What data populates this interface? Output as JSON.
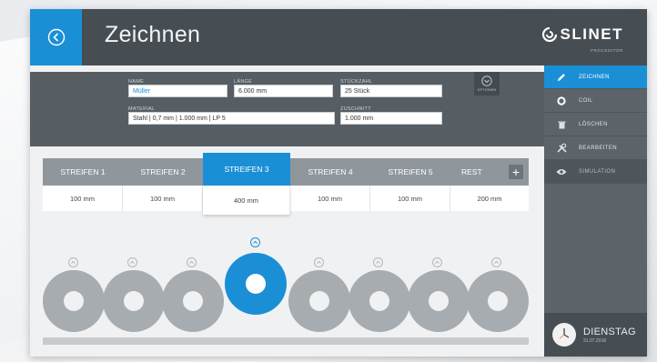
{
  "header": {
    "title": "Zeichnen",
    "brand": "SLINET",
    "brand_sub": "PROCEDITOR"
  },
  "form": {
    "name_label": "NAME",
    "name_value": "Müller",
    "laenge_label": "LÄNGE",
    "laenge_value": "6.000 mm",
    "stueckzahl_label": "STÜCKZAHL",
    "stueckzahl_value": "25 Stück",
    "material_label": "MATERIAL",
    "material_value": "Stahl | 0,7 mm | 1.000 mm | LP 5",
    "zuschnitt_label": "ZUSCHNITT",
    "zuschnitt_value": "1.000 mm",
    "optionen_label": "OPTIONEN"
  },
  "tabs": [
    {
      "label": "STREIFEN 1",
      "value": "100 mm"
    },
    {
      "label": "STREIFEN 2",
      "value": "100 mm"
    },
    {
      "label": "STREIFEN 3",
      "value": "400 mm"
    },
    {
      "label": "STREIFEN 4",
      "value": "100 mm"
    },
    {
      "label": "STREIFEN 5",
      "value": "100 mm"
    },
    {
      "label": "REST",
      "value": "200 mm"
    }
  ],
  "add_label": "+",
  "sidebar": {
    "items": [
      {
        "label": "ZEICHNEN",
        "icon": "pencil-icon"
      },
      {
        "label": "COIL",
        "icon": "coil-icon"
      },
      {
        "label": "LÖSCHEN",
        "icon": "trash-icon"
      },
      {
        "label": "BEARBEITEN",
        "icon": "tools-icon"
      },
      {
        "label": "SIMULATION",
        "icon": "eye-icon"
      }
    ],
    "day": "DIENSTAG",
    "date": "31.07.2018"
  },
  "colors": {
    "accent": "#1b8fd6",
    "header": "#474e53",
    "sidebar": "#5c6469",
    "coil": "#a7acb0"
  }
}
